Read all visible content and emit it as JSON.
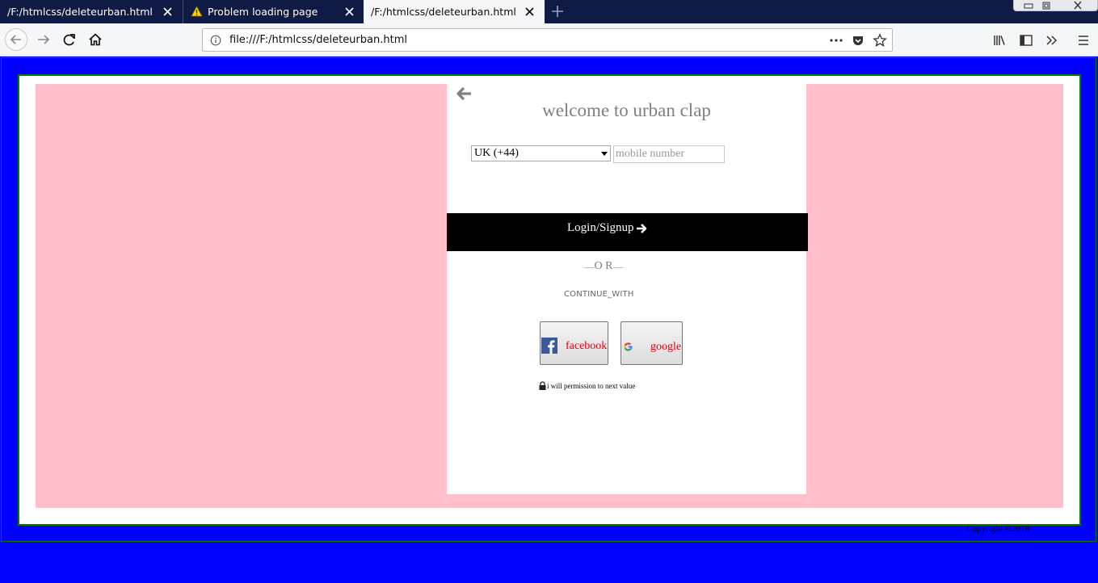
{
  "browser": {
    "tabs": [
      {
        "title": "/F:/htmlcss/deleteurban.html",
        "active": false
      },
      {
        "title": "Problem loading page",
        "active": false,
        "icon": "warning-icon"
      },
      {
        "title": "/F:/htmlcss/deleteurban.html",
        "active": true
      }
    ],
    "url": "file:///F:/htmlcss/deleteurban.html"
  },
  "page": {
    "background_color": "#0000ff",
    "panel_color": "#ffc0cb",
    "border_color": "#008000",
    "welcome": "welcome to urban clap",
    "country_select": {
      "selected": "UK (+44)"
    },
    "mobile_input": {
      "placeholder": "mobile number"
    },
    "login_button": "Login/Signup",
    "or_text": "O R",
    "continue_text": "CONTINUE_WITH",
    "facebook_label": "facebook",
    "google_label": "google",
    "permission_text": "i will permission to next value",
    "copyright": "Copyright ©2018"
  }
}
